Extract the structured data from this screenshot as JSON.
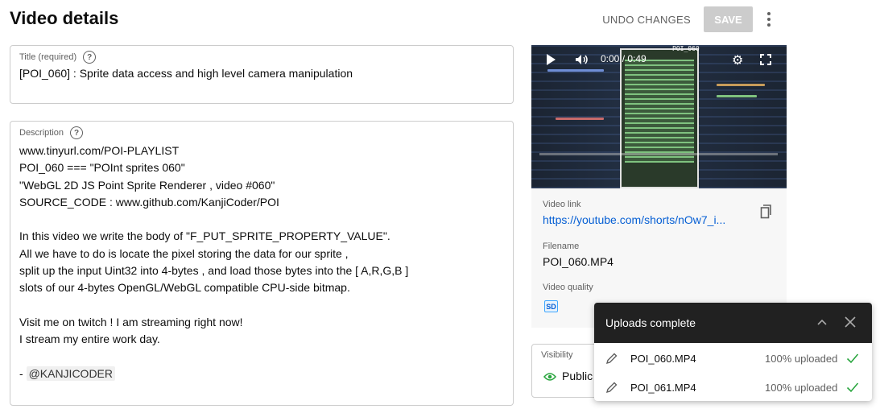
{
  "page": {
    "title": "Video details"
  },
  "toolbar": {
    "undo_label": "UNDO CHANGES",
    "save_label": "SAVE"
  },
  "title_field": {
    "label": "Title (required)",
    "value": "[POI_060] : Sprite data access and high level camera manipulation"
  },
  "description_field": {
    "label": "Description",
    "lines": [
      "www.tinyurl.com/POI-PLAYLIST",
      "POI_060 === \"POInt sprites 060\"",
      "\"WebGL 2D JS Point Sprite Renderer , video #060\"",
      "SOURCE_CODE : www.github.com/KanjiCoder/POI",
      "",
      "In this video we write the body of \"F_PUT_SPRITE_PROPERTY_VALUE\".",
      "All we have to do is locate the pixel storing the data for our sprite ,",
      "split up the input Uint32 into 4-bytes , and load those bytes into the [ A,R,G,B ]",
      "slots of our 4-bytes OpenGL/WebGL compatible CPU-side bitmap.",
      "",
      "Visit me on twitch ! I am streaming right now!",
      "I stream my entire work day.",
      ""
    ],
    "signoff_prefix": "- ",
    "hashtag": "@KANJICODER"
  },
  "player": {
    "overlay_label": "POI_060",
    "time": "0:00 / 0:49",
    "progress_fraction": 0
  },
  "video_info": {
    "link_label": "Video link",
    "link": "https://youtube.com/shorts/nOw7_i...",
    "filename_label": "Filename",
    "filename": "POI_060.MP4",
    "quality_label": "Video quality",
    "quality_badge": "SD"
  },
  "visibility": {
    "label": "Visibility",
    "value": "Public"
  },
  "uploads": {
    "title": "Uploads complete",
    "items": [
      {
        "name": "POI_060.MP4",
        "status": "100% uploaded"
      },
      {
        "name": "POI_061.MP4",
        "status": "100% uploaded"
      }
    ]
  },
  "colors": {
    "link": "#065fd4",
    "success": "#2ba640",
    "save_disabled_bg": "#cccccc",
    "panel_header_bg": "#212121"
  }
}
